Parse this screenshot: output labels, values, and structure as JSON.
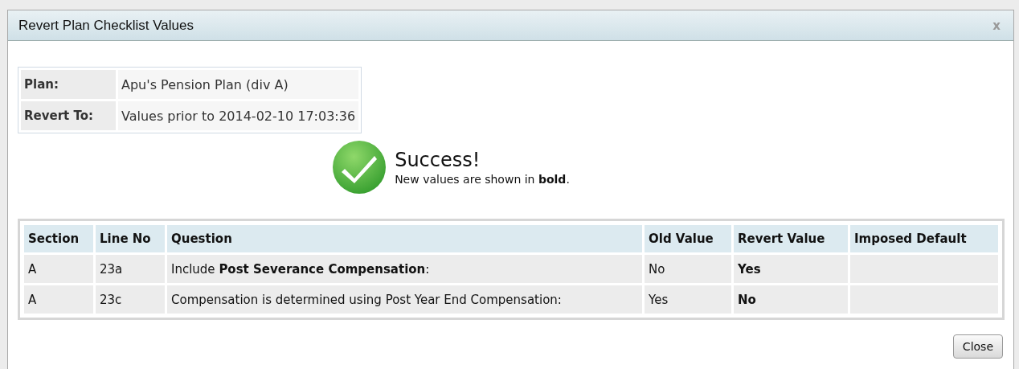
{
  "window": {
    "title": "Revert Plan Checklist Values",
    "close": "x"
  },
  "info": [
    {
      "label": "Plan:",
      "value": "Apu's Pension Plan (div A)"
    },
    {
      "label": "Revert To:",
      "value": "Values prior to 2014-02-10 17:03:36"
    }
  ],
  "message": {
    "title": "Success!",
    "text": "New values are shown in **bold**."
  },
  "table": {
    "columns": [
      "Section",
      "Line No",
      "Question",
      "Old Value",
      "Revert Value",
      "Imposed Default"
    ],
    "rows": [
      {
        "section": "A",
        "line_no": "23a",
        "question": "Include **Post Severance Compensation**:",
        "old_value": "No",
        "revert_value": "Yes"
      },
      {
        "section": "A",
        "line_no": "23c",
        "question": "Compensation is determined using Post Year End Compensation:",
        "old_value": "Yes",
        "revert_value": "No"
      }
    ]
  },
  "buttons": [
    "Close"
  ]
}
